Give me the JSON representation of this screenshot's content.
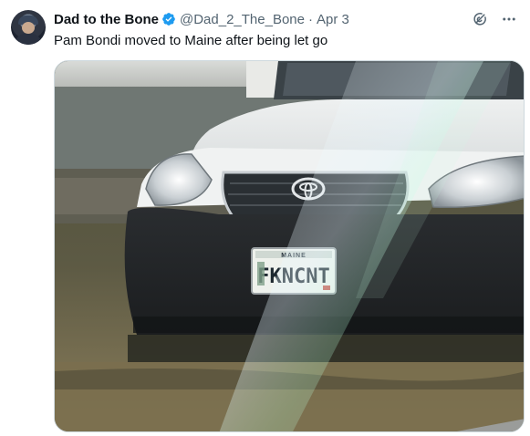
{
  "author": {
    "display_name": "Dad to the Bone",
    "handle": "@Dad_2_The_Bone",
    "date": "Apr 3",
    "separator": "·",
    "verified": true
  },
  "tweet": {
    "text": "Pam Bondi moved to Maine after being let go"
  },
  "media": {
    "plate_state": "MAINE",
    "plate_text": "FKNCNT",
    "vehicle_badge": "toyota-logo"
  },
  "icons": {
    "grok": "grok-icon",
    "more": "more-icon",
    "verified": "verified-badge-icon"
  },
  "colors": {
    "verified_blue": "#1d9bf0",
    "secondary_text": "#536471",
    "primary_text": "#0f1419"
  }
}
